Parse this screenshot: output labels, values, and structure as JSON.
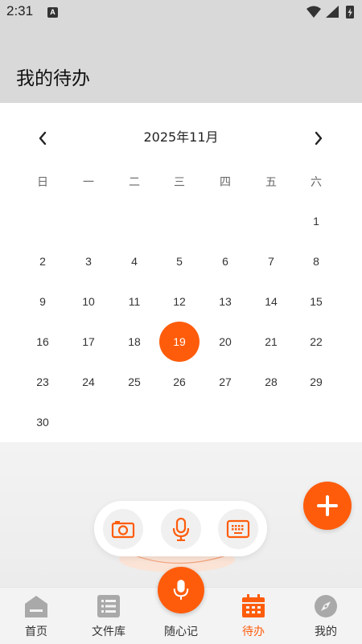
{
  "status_bar": {
    "time": "2:31",
    "notification_badge": "A"
  },
  "header": {
    "title": "我的待办"
  },
  "calendar": {
    "month_title": "2025年11月",
    "weekdays": [
      "日",
      "一",
      "二",
      "三",
      "四",
      "五",
      "六"
    ],
    "selected_day": "19",
    "weeks": [
      [
        "",
        "",
        "",
        "",
        "",
        "",
        "1"
      ],
      [
        "2",
        "3",
        "4",
        "5",
        "6",
        "7",
        "8"
      ],
      [
        "9",
        "10",
        "11",
        "12",
        "13",
        "14",
        "15"
      ],
      [
        "16",
        "17",
        "18",
        "19",
        "20",
        "21",
        "22"
      ],
      [
        "23",
        "24",
        "25",
        "26",
        "27",
        "28",
        "29"
      ],
      [
        "30",
        "",
        "",
        "",
        "",
        "",
        ""
      ]
    ]
  },
  "quick_actions": [
    {
      "icon": "camera-icon"
    },
    {
      "icon": "microphone-icon"
    },
    {
      "icon": "keyboard-icon"
    }
  ],
  "bottom_nav": {
    "items": [
      {
        "label": "首页",
        "icon": "home-icon"
      },
      {
        "label": "文件库",
        "icon": "file-library-icon"
      },
      {
        "label": "随心记",
        "icon": "microphone-icon"
      },
      {
        "label": "待办",
        "icon": "calendar-icon",
        "active": true
      },
      {
        "label": "我的",
        "icon": "compass-icon"
      }
    ]
  },
  "colors": {
    "accent": "#fe5c0b",
    "header_bg": "#d9d9d9"
  }
}
